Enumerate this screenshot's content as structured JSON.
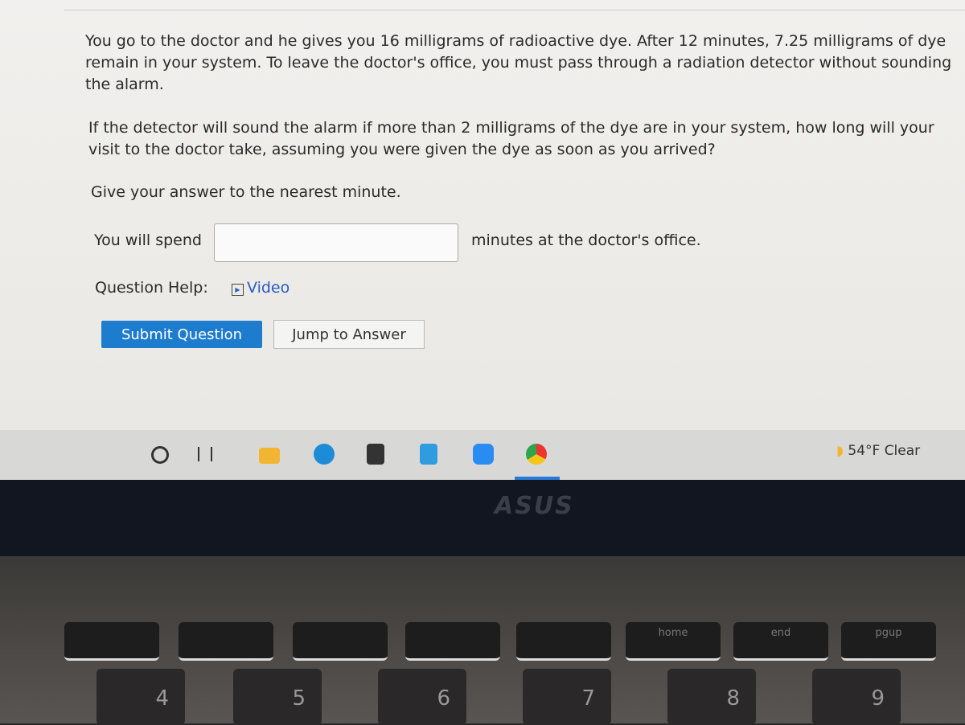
{
  "question": {
    "paragraph1": "You go to the doctor and he gives you 16 milligrams of radioactive dye. After 12 minutes, 7.25 milligrams of dye remain in your system. To leave the doctor's office, you must pass through a radiation detector without sounding the alarm.",
    "paragraph2": "If the detector will sound the alarm if more than 2 milligrams of the dye are in your system, how long will your visit to the doctor take, assuming you were given the dye as soon as you arrived?",
    "instruction": "Give your answer to the nearest minute.",
    "answer_prefix": "You will spend",
    "answer_value": "",
    "answer_suffix": "minutes at the doctor's office.",
    "help_label": "Question Help:",
    "video_label": "Video",
    "submit_label": "Submit Question",
    "jump_label": "Jump to Answer"
  },
  "taskbar": {
    "icons": [
      "search-icon",
      "task-view-icon",
      "file-explorer-icon",
      "edge-icon",
      "store-icon",
      "mail-icon",
      "zoom-icon",
      "chrome-icon"
    ],
    "weather": "54°F  Clear"
  },
  "bezel": {
    "brand": "ASUS"
  },
  "keyboard": {
    "fkeys": [
      "",
      "",
      "",
      "",
      "",
      "",
      "home",
      "end",
      "pgup"
    ],
    "numbers": [
      "4",
      "5",
      "6",
      "7",
      "8",
      "9"
    ]
  }
}
